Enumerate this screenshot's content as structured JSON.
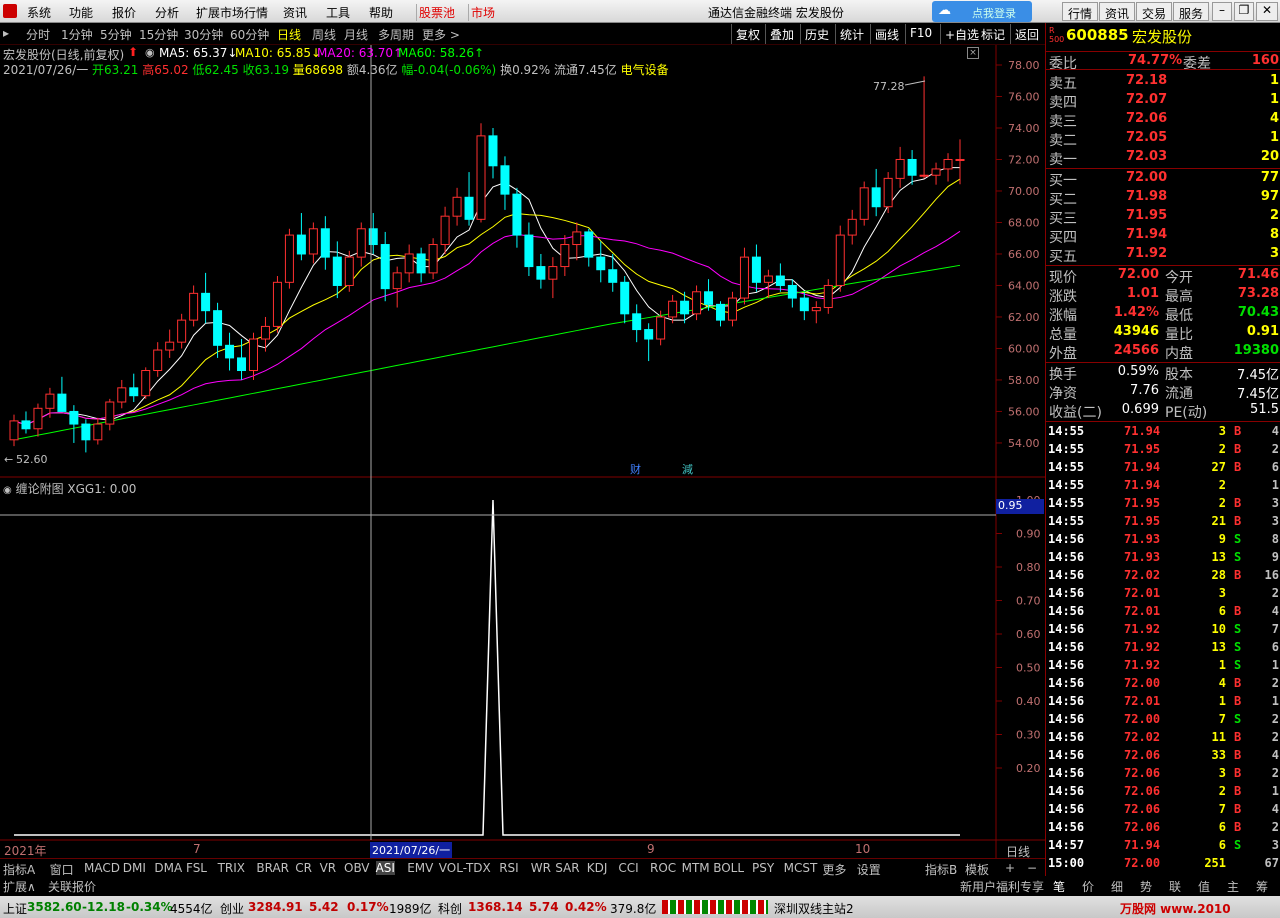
{
  "menubar": {
    "items": [
      "系统",
      "功能",
      "报价",
      "分析",
      "扩展市场行情",
      "资讯",
      "工具",
      "帮助"
    ],
    "highlight": [
      "股票池",
      "市场"
    ],
    "title": "通达信金融终端  宏发股份",
    "right_buttons": [
      "行情",
      "资讯",
      "交易",
      "服务"
    ],
    "login_label": "点我登录"
  },
  "toolbar": {
    "periods": [
      "分时",
      "1分钟",
      "5分钟",
      "15分钟",
      "30分钟",
      "60分钟",
      "日线",
      "周线",
      "月线",
      "多周期",
      "更多 >"
    ],
    "active_period": "日线",
    "right": [
      "复权",
      "叠加",
      "历史",
      "统计",
      "画线",
      "F10",
      "+自选",
      "返回"
    ]
  },
  "main_chart": {
    "title": "宏发股份(日线,前复权)",
    "ma_labels": [
      {
        "text": "MA5: 65.37↓",
        "color": "#ffffff"
      },
      {
        "text": "MA10: 65.85↓",
        "color": "#ffff00"
      },
      {
        "text": "MA20: 63.70↑",
        "color": "#ff00ff"
      },
      {
        "text": "MA60: 58.26↑",
        "color": "#00ff00"
      }
    ],
    "info_line": {
      "date": "2021/07/26/一",
      "open": "开63.21",
      "high": "高65.02",
      "low": "低62.45",
      "close": "收63.19",
      "volume": "量68698",
      "amount": "额4.36亿",
      "change": "幅-0.04(-0.06%)",
      "turnover": "换0.92%",
      "float": "流通7.45亿",
      "sector": "电气设备"
    },
    "y_ticks": [
      "78.00",
      "76.00",
      "74.00",
      "72.00",
      "70.00",
      "68.00",
      "66.00",
      "64.00",
      "62.00",
      "60.00",
      "58.00",
      "56.00",
      "54.00"
    ],
    "high_marker": "77.28",
    "low_marker": "52.60",
    "events": [
      "财",
      "減"
    ]
  },
  "sub_chart": {
    "title": "缠论附图 XGG1: 0.00",
    "y_ticks": [
      "1.00",
      "0.90",
      "0.80",
      "0.70",
      "0.60",
      "0.50",
      "0.40",
      "0.30",
      "0.20"
    ],
    "cursor_value": "0.95"
  },
  "x_axis": {
    "labels": [
      "2021年",
      "7",
      "9",
      "10"
    ],
    "cursor_date": "2021/07/26/一",
    "right_label": "日线"
  },
  "quote": {
    "code": "600885",
    "name": "宏发股份",
    "weibi_label": "委比",
    "weibi_value": "74.77%",
    "weicha_label": "委差",
    "weicha_value": "160",
    "sells": [
      {
        "label": "卖五",
        "price": "72.18",
        "vol": "1"
      },
      {
        "label": "卖四",
        "price": "72.07",
        "vol": "1"
      },
      {
        "label": "卖三",
        "price": "72.06",
        "vol": "4"
      },
      {
        "label": "卖二",
        "price": "72.05",
        "vol": "1"
      },
      {
        "label": "卖一",
        "price": "72.03",
        "vol": "20"
      }
    ],
    "buys": [
      {
        "label": "买一",
        "price": "72.00",
        "vol": "77"
      },
      {
        "label": "买二",
        "price": "71.98",
        "vol": "97"
      },
      {
        "label": "买三",
        "price": "71.95",
        "vol": "2"
      },
      {
        "label": "买四",
        "price": "71.94",
        "vol": "8"
      },
      {
        "label": "买五",
        "price": "71.92",
        "vol": "3"
      }
    ],
    "stats": [
      {
        "l1": "现价",
        "v1": "72.00",
        "c1": "red",
        "l2": "今开",
        "v2": "71.46",
        "c2": "red"
      },
      {
        "l1": "涨跌",
        "v1": "1.01",
        "c1": "red",
        "l2": "最高",
        "v2": "73.28",
        "c2": "red"
      },
      {
        "l1": "涨幅",
        "v1": "1.42%",
        "c1": "red",
        "l2": "最低",
        "v2": "70.43",
        "c2": "green"
      },
      {
        "l1": "总量",
        "v1": "43946",
        "c1": "yellow",
        "l2": "量比",
        "v2": "0.91",
        "c2": "yellow"
      },
      {
        "l1": "外盘",
        "v1": "24566",
        "c1": "red",
        "l2": "内盘",
        "v2": "19380",
        "c2": "green"
      }
    ],
    "stats2": [
      {
        "l1": "换手",
        "v1": "0.59%",
        "l2": "股本",
        "v2": "7.45亿"
      },
      {
        "l1": "净资",
        "v1": "7.76",
        "l2": "流通",
        "v2": "7.45亿"
      },
      {
        "l1": "收益(二)",
        "v1": "0.699",
        "l2": "PE(动)",
        "v2": "51.5"
      }
    ]
  },
  "trades": [
    {
      "t": "14:55",
      "p": "71.94",
      "pc": "red",
      "v": "3",
      "s": "B",
      "n": "4"
    },
    {
      "t": "14:55",
      "p": "71.95",
      "pc": "red",
      "v": "2",
      "s": "B",
      "n": "2"
    },
    {
      "t": "14:55",
      "p": "71.94",
      "pc": "red",
      "v": "27",
      "s": "B",
      "n": "6"
    },
    {
      "t": "14:55",
      "p": "71.94",
      "pc": "red",
      "v": "2",
      "s": "",
      "n": "1"
    },
    {
      "t": "14:55",
      "p": "71.95",
      "pc": "red",
      "v": "2",
      "s": "B",
      "n": "3"
    },
    {
      "t": "14:55",
      "p": "71.95",
      "pc": "red",
      "v": "21",
      "s": "B",
      "n": "3"
    },
    {
      "t": "14:56",
      "p": "71.93",
      "pc": "red",
      "v": "9",
      "s": "S",
      "n": "8"
    },
    {
      "t": "14:56",
      "p": "71.93",
      "pc": "red",
      "v": "13",
      "s": "S",
      "n": "9"
    },
    {
      "t": "14:56",
      "p": "72.02",
      "pc": "red",
      "v": "28",
      "s": "B",
      "n": "16"
    },
    {
      "t": "14:56",
      "p": "72.01",
      "pc": "red",
      "v": "3",
      "s": "",
      "n": "2"
    },
    {
      "t": "14:56",
      "p": "72.01",
      "pc": "red",
      "v": "6",
      "s": "B",
      "n": "4"
    },
    {
      "t": "14:56",
      "p": "71.92",
      "pc": "red",
      "v": "10",
      "s": "S",
      "n": "7"
    },
    {
      "t": "14:56",
      "p": "71.92",
      "pc": "red",
      "v": "13",
      "s": "S",
      "n": "6"
    },
    {
      "t": "14:56",
      "p": "71.92",
      "pc": "red",
      "v": "1",
      "s": "S",
      "n": "1"
    },
    {
      "t": "14:56",
      "p": "72.00",
      "pc": "red",
      "v": "4",
      "s": "B",
      "n": "2"
    },
    {
      "t": "14:56",
      "p": "72.01",
      "pc": "red",
      "v": "1",
      "s": "B",
      "n": "1"
    },
    {
      "t": "14:56",
      "p": "72.00",
      "pc": "red",
      "v": "7",
      "s": "S",
      "n": "2"
    },
    {
      "t": "14:56",
      "p": "72.02",
      "pc": "red",
      "v": "11",
      "s": "B",
      "n": "2"
    },
    {
      "t": "14:56",
      "p": "72.06",
      "pc": "red",
      "v": "33",
      "s": "B",
      "n": "4"
    },
    {
      "t": "14:56",
      "p": "72.06",
      "pc": "red",
      "v": "3",
      "s": "B",
      "n": "2"
    },
    {
      "t": "14:56",
      "p": "72.06",
      "pc": "red",
      "v": "2",
      "s": "B",
      "n": "1"
    },
    {
      "t": "14:56",
      "p": "72.06",
      "pc": "red",
      "v": "7",
      "s": "B",
      "n": "4"
    },
    {
      "t": "14:56",
      "p": "72.06",
      "pc": "red",
      "v": "6",
      "s": "B",
      "n": "2"
    },
    {
      "t": "14:57",
      "p": "71.94",
      "pc": "red",
      "v": "6",
      "s": "S",
      "n": "3"
    },
    {
      "t": "15:00",
      "p": "72.00",
      "pc": "red",
      "v": "251",
      "s": "",
      "n": "67"
    }
  ],
  "bottom_tabs": [
    "指标A",
    "窗口",
    "MACD",
    "DMI",
    "DMA",
    "FSL",
    "TRIX",
    "BRAR",
    "CR",
    "VR",
    "OBV",
    "ASI",
    "EMV",
    "VOL-TDX",
    "RSI",
    "WR",
    "SAR",
    "KDJ",
    "CCI",
    "ROC",
    "MTM",
    "BOLL",
    "PSY",
    "MCST",
    "更多",
    "设置"
  ],
  "bottom_right": [
    "指标B",
    "模板",
    "+",
    "−"
  ],
  "ext": {
    "left": [
      "扩展∧",
      "关联报价"
    ],
    "right": "新用户福利专享",
    "panel_tabs": [
      "笔",
      "价",
      "细",
      "势",
      "联",
      "值",
      "主",
      "筹"
    ]
  },
  "status": {
    "sh_label": "上证",
    "sh_val": "3582.60",
    "sh_chg": "-12.18",
    "sh_pct": "-0.34%",
    "sh_amt": "4554亿",
    "cy_label": "创业",
    "cy_val": "3284.91",
    "cy_chg": "5.42",
    "cy_pct": "0.17%",
    "cy_amt": "1989亿",
    "kc_label": "科创",
    "kc_val": "1368.14",
    "kc_chg": "5.74",
    "kc_pct": "0.42%",
    "kc_amt": "379.8亿",
    "server": "深圳双线主站2",
    "watermark": "万股网 www.2010"
  },
  "chart_data": {
    "type": "candlestick",
    "ylim": [
      52.6,
      78.0
    ],
    "candles": [
      [
        54.2,
        55.8,
        53.8,
        55.4
      ],
      [
        55.4,
        56.0,
        54.6,
        54.9
      ],
      [
        54.9,
        56.5,
        54.4,
        56.2
      ],
      [
        56.2,
        57.5,
        55.6,
        57.1
      ],
      [
        57.1,
        58.2,
        56.6,
        56.0
      ],
      [
        56.0,
        56.4,
        54.0,
        55.2
      ],
      [
        55.2,
        55.5,
        53.4,
        54.2
      ],
      [
        54.2,
        55.6,
        53.9,
        55.2
      ],
      [
        55.2,
        56.8,
        54.8,
        56.6
      ],
      [
        56.6,
        58.0,
        56.2,
        57.5
      ],
      [
        57.5,
        58.4,
        56.6,
        57.0
      ],
      [
        57.0,
        58.8,
        56.8,
        58.6
      ],
      [
        58.6,
        60.4,
        58.2,
        59.9
      ],
      [
        59.9,
        61.2,
        59.4,
        60.4
      ],
      [
        60.4,
        62.2,
        60.0,
        61.8
      ],
      [
        61.8,
        64.0,
        61.4,
        63.5
      ],
      [
        63.5,
        64.8,
        61.6,
        62.4
      ],
      [
        62.4,
        62.9,
        59.4,
        60.2
      ],
      [
        60.2,
        61.0,
        58.6,
        59.4
      ],
      [
        59.4,
        60.6,
        58.0,
        58.6
      ],
      [
        58.6,
        61.0,
        58.0,
        60.6
      ],
      [
        60.6,
        62.0,
        59.8,
        61.4
      ],
      [
        61.4,
        64.6,
        61.0,
        64.2
      ],
      [
        64.2,
        67.6,
        63.8,
        67.2
      ],
      [
        67.2,
        68.6,
        65.6,
        66.0
      ],
      [
        66.0,
        68.0,
        65.4,
        67.6
      ],
      [
        67.6,
        68.4,
        65.0,
        65.8
      ],
      [
        65.8,
        66.8,
        63.2,
        64.0
      ],
      [
        64.0,
        66.2,
        63.6,
        65.8
      ],
      [
        65.8,
        68.0,
        65.2,
        67.6
      ],
      [
        67.6,
        68.6,
        66.0,
        66.6
      ],
      [
        66.6,
        67.4,
        63.0,
        63.8
      ],
      [
        63.8,
        65.2,
        62.6,
        64.8
      ],
      [
        64.8,
        66.6,
        64.2,
        66.0
      ],
      [
        66.0,
        66.4,
        64.2,
        64.8
      ],
      [
        64.8,
        67.0,
        64.4,
        66.6
      ],
      [
        66.6,
        69.0,
        66.0,
        68.4
      ],
      [
        68.4,
        70.2,
        67.8,
        69.6
      ],
      [
        69.6,
        71.2,
        67.8,
        68.2
      ],
      [
        68.2,
        74.3,
        68.0,
        73.5
      ],
      [
        73.5,
        74.0,
        70.8,
        71.6
      ],
      [
        71.6,
        72.2,
        68.8,
        69.8
      ],
      [
        69.8,
        70.2,
        66.4,
        67.2
      ],
      [
        67.2,
        68.0,
        64.6,
        65.2
      ],
      [
        65.2,
        66.0,
        63.8,
        64.4
      ],
      [
        64.4,
        65.8,
        63.2,
        65.2
      ],
      [
        65.2,
        67.2,
        64.6,
        66.6
      ],
      [
        66.6,
        68.0,
        65.6,
        67.4
      ],
      [
        67.4,
        67.6,
        65.2,
        65.8
      ],
      [
        65.8,
        66.8,
        64.2,
        65.0
      ],
      [
        65.0,
        66.0,
        63.6,
        64.2
      ],
      [
        64.2,
        64.6,
        61.6,
        62.2
      ],
      [
        62.2,
        62.8,
        60.4,
        61.2
      ],
      [
        61.2,
        61.6,
        59.2,
        60.6
      ],
      [
        60.6,
        62.4,
        60.2,
        62.0
      ],
      [
        62.0,
        63.4,
        61.6,
        63.0
      ],
      [
        63.0,
        63.6,
        61.6,
        62.2
      ],
      [
        62.2,
        64.0,
        61.8,
        63.6
      ],
      [
        63.6,
        64.4,
        62.4,
        62.8
      ],
      [
        62.8,
        63.0,
        61.4,
        61.8
      ],
      [
        61.8,
        63.6,
        61.4,
        63.2
      ],
      [
        63.2,
        66.4,
        62.8,
        65.8
      ],
      [
        65.8,
        66.6,
        63.6,
        64.2
      ],
      [
        64.2,
        65.0,
        63.2,
        64.6
      ],
      [
        64.6,
        65.4,
        63.6,
        64.0
      ],
      [
        64.0,
        64.4,
        62.6,
        63.2
      ],
      [
        63.2,
        63.6,
        61.8,
        62.4
      ],
      [
        62.4,
        63.0,
        61.6,
        62.6
      ],
      [
        62.6,
        64.4,
        62.2,
        64.0
      ],
      [
        64.0,
        67.8,
        63.6,
        67.2
      ],
      [
        67.2,
        68.8,
        66.6,
        68.2
      ],
      [
        68.2,
        70.6,
        67.8,
        70.2
      ],
      [
        70.2,
        71.4,
        68.4,
        69.0
      ],
      [
        69.0,
        71.2,
        68.6,
        70.8
      ],
      [
        70.8,
        72.8,
        70.2,
        72.0
      ],
      [
        72.0,
        72.6,
        70.4,
        71.0
      ],
      [
        71.0,
        77.28,
        70.8,
        71.0
      ],
      [
        71.0,
        71.8,
        70.4,
        71.4
      ],
      [
        71.4,
        72.4,
        70.6,
        72.0
      ],
      [
        72.0,
        73.28,
        70.43,
        72.0
      ]
    ],
    "cursor_index": 27,
    "sub_series": {
      "name": "XGG1",
      "peak_index": 40,
      "peak_value": 1.0,
      "base_value": 0.0
    },
    "ma5_end": 65.37,
    "ma10_end": 65.85,
    "ma20_end": 63.7,
    "ma60_end": 58.26
  }
}
